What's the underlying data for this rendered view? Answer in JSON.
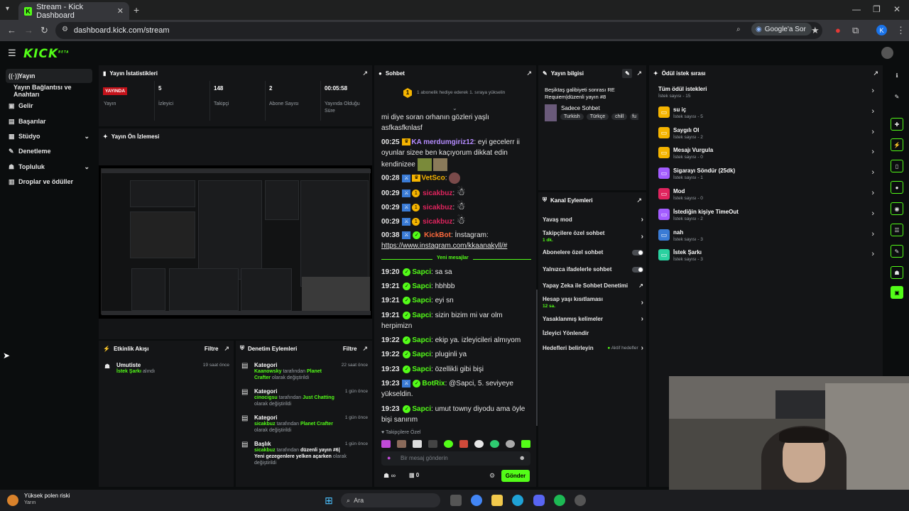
{
  "browser": {
    "tab_title": "Stream - Kick Dashboard",
    "url": "dashboard.kick.com/stream",
    "google_sor": "Google'a Sor",
    "profile_initial": "K"
  },
  "app": {
    "logo": "KICK",
    "logo_sup": "BETA"
  },
  "sidebar": {
    "items": [
      {
        "label": "Yayın",
        "icon": "broadcast-icon"
      },
      {
        "label": "Yayın Bağlantısı ve Anahtarı",
        "icon": ""
      },
      {
        "label": "Gelir",
        "icon": "wallet-icon"
      },
      {
        "label": "Başarılar",
        "icon": "trophy-icon"
      },
      {
        "label": "Stüdyo",
        "icon": "studio-icon"
      },
      {
        "label": "Denetleme",
        "icon": "wrench-icon"
      },
      {
        "label": "Topluluk",
        "icon": "people-icon"
      },
      {
        "label": "Droplar ve ödüller",
        "icon": "gift-icon"
      }
    ]
  },
  "stats": {
    "title": "Yayın İstatistikleri",
    "status_badge": "YAYINDA",
    "status_label": "Yayın",
    "viewers_value": "5",
    "viewers_label": "İzleyici",
    "followers_value": "148",
    "followers_label": "Takipçi",
    "subs_value": "2",
    "subs_label": "Abone Sayısı",
    "uptime_value": "00:05:58",
    "uptime_label": "Yayında Olduğu Süre"
  },
  "preview": {
    "title": "Yayın Ön İzlemesi"
  },
  "activity": {
    "title": "Etkinlik Akışı",
    "filter": "Filtre",
    "items": [
      {
        "user": "Umutiste",
        "detail_prefix": "İstek Şarkı",
        "detail_suffix": "alındı",
        "time": "19 saat önce"
      }
    ]
  },
  "moderation": {
    "title": "Denetim Eylemleri",
    "filter": "Filtre",
    "items": [
      {
        "title": "Kategori",
        "actor": "Kaanowsky",
        "middle": "tarafından",
        "target": "Planet Crafter",
        "suffix": "olarak değiştirildi",
        "time": "22 saat önce"
      },
      {
        "title": "Kategori",
        "actor": "cinocigsu",
        "middle": "tarafından",
        "target": "Just Chatting",
        "suffix": "olarak değiştirildi",
        "time": "1 gün önce"
      },
      {
        "title": "Kategori",
        "actor": "sicakbuz",
        "middle": "tarafından",
        "target": "Planet Crafter",
        "suffix": "olarak değiştirildi",
        "time": "1 gün önce"
      },
      {
        "title": "Başlık",
        "actor": "sicakbuz",
        "middle": "tarafından",
        "target": "düzenli yayın #6| Yeni gezegenlere yelken açarken",
        "suffix": "olarak değiştirildi",
        "time": "1 gün önce"
      }
    ]
  },
  "chat": {
    "title": "Sohbet",
    "pinned": "1 abonelik hediye ederek 1. sıraya yükselin",
    "pinned_num": "1",
    "new_messages": "Yeni mesajlar",
    "lines_old": [
      {
        "time": "",
        "user": "",
        "text": "mi diye soran orhanın gözleri yaşlı asfkasfknlasf"
      },
      {
        "time": "00:25",
        "user": "KA merdumgiriz12",
        "text": "eyi gecelerr ii oyunlar sizee ben kaçıyorum dikkat edin kendinizee"
      },
      {
        "time": "00:28",
        "user": "VetSco",
        "text": ""
      },
      {
        "time": "00:29",
        "user": "sicakbuz",
        "text": ""
      },
      {
        "time": "00:29",
        "user": "sicakbuz",
        "text": ""
      },
      {
        "time": "00:29",
        "user": "sicakbuz",
        "text": ""
      },
      {
        "time": "00:38",
        "user": "KickBot",
        "text": "İnstagram:"
      },
      {
        "time": "",
        "user": "",
        "text": "https://www.instagram.com/kkaanakyll/#"
      }
    ],
    "lines_new": [
      {
        "time": "19:20",
        "user": "Sapci",
        "text": "sa sa"
      },
      {
        "time": "19:21",
        "user": "Sapci",
        "text": "hbhbb"
      },
      {
        "time": "19:21",
        "user": "Sapci",
        "text": "eyi sn"
      },
      {
        "time": "19:21",
        "user": "Sapci",
        "text": "sizin bizim mi var olm herpimizn"
      },
      {
        "time": "19:22",
        "user": "Sapci",
        "text": "ekip ya. izleyicileri almıyom"
      },
      {
        "time": "19:22",
        "user": "Sapci",
        "text": "pluginli ya"
      },
      {
        "time": "19:23",
        "user": "Sapci",
        "text": "özellikli gibi bişi"
      },
      {
        "time": "19:23",
        "user": "BotRix",
        "text": "@Sapci, 5. seviyeye yükseldin."
      },
      {
        "time": "19:23",
        "user": "Sapci",
        "text": "umut towny diyodu ama öyle bişi sanırım"
      }
    ],
    "followers_only": "Takipçilere Özel",
    "input_placeholder": "Bir mesaj gönderin",
    "send": "Gönder",
    "infinity": "∞",
    "count": "0"
  },
  "stream_info": {
    "title": "Yayın bilgisi",
    "stream_title": "Beşiktaş galibiyeti sonrası RE Requiem|düzenli yayın #8",
    "category": "Sadece Sohbet",
    "tags": [
      "Turkish",
      "Türkçe",
      "chill",
      "fu"
    ]
  },
  "channel_actions": {
    "title": "Kanal Eylemleri",
    "slow_mode": "Yavaş mod",
    "followers_only": "Takipçilere özel sohbet",
    "followers_only_sub": "1 dk.",
    "subs_only": "Abonelere özel sohbet",
    "emotes_only": "Yalnızca ifadelerle sohbet",
    "ai_mod": "Yapay Zeka ile Sohbet Denetimi",
    "account_age": "Hesap yaşı kısıtlaması",
    "account_age_sub": "12 sa.",
    "banned_words": "Yasaklanmış kelimeler",
    "viewer_redirect": "İzleyici Yönlendir",
    "goals": "Hedefleri belirleyin",
    "goals_status": "Aktif hedefler"
  },
  "rewards": {
    "title": "Ödül istek sırası",
    "all_label": "Tüm ödül istekleri",
    "all_count": "İstek sayısı - 15",
    "items": [
      {
        "name": "su iç",
        "count": "İstek sayısı - 5",
        "color": "#f5b400"
      },
      {
        "name": "Saygılı Ol",
        "count": "İstek sayısı - 2",
        "color": "#f5b400"
      },
      {
        "name": "Mesajı Vurgula",
        "count": "İstek sayısı - 0",
        "color": "#f5b400"
      },
      {
        "name": "Sigarayı Söndür (25dk)",
        "count": "İstek sayısı - 1",
        "color": "#a35cff"
      },
      {
        "name": "Mod",
        "count": "İstek sayısı - 0",
        "color": "#e0245e"
      },
      {
        "name": "İstediğin kişiye TimeOut",
        "count": "İstek sayısı - 2",
        "color": "#a35cff"
      },
      {
        "name": "nah",
        "count": "İstek sayısı - 3",
        "color": "#3a7bd5"
      },
      {
        "name": "İstek Şarkı",
        "count": "İstek sayısı - 3",
        "color": "#2ad1a0"
      }
    ]
  },
  "taskbar": {
    "weather_title": "Yüksek polen riski",
    "weather_sub": "Yarın",
    "search": "Ara"
  },
  "colors": {
    "accent": "#53fc18",
    "panel": "#141517",
    "bg": "#0b0d0e"
  }
}
